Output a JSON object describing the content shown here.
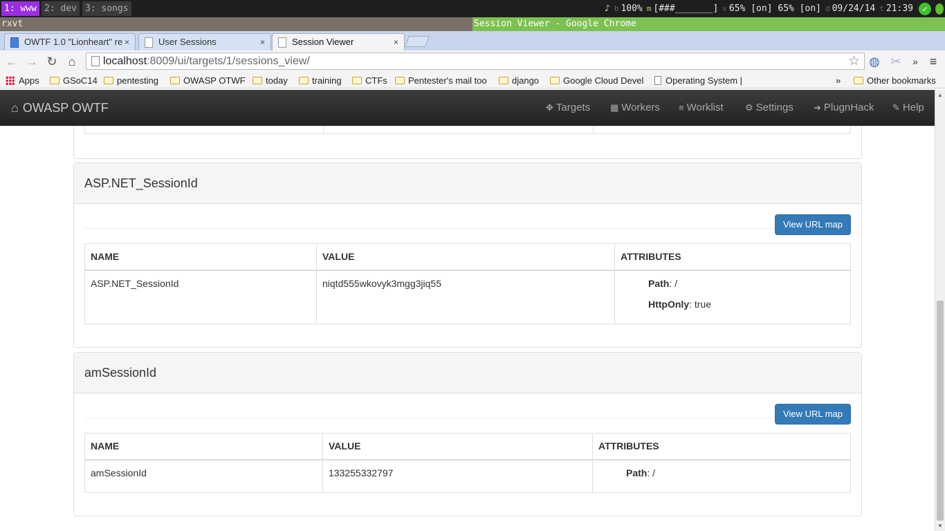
{
  "wm": {
    "workspaces": [
      "1: www",
      "2: dev",
      "3: songs"
    ],
    "status": {
      "music_icon": "♪",
      "brightness_icon": "b",
      "brightness": "100%",
      "mem_icon": "m",
      "mem_bar": "[###_______]",
      "vol_icon": "v",
      "volume": "65% [on] 65% [on]",
      "date_icon": "d",
      "date": "09/24/14",
      "time_icon": "t",
      "time": "21:39"
    }
  },
  "titlebar": {
    "left": "rxvt",
    "right": "Session Viewer - Google Chrome"
  },
  "tabs": [
    {
      "label": "OWTF 1.0 \"Lionheart\" re",
      "close": "×"
    },
    {
      "label": "User Sessions",
      "close": "×"
    },
    {
      "label": "Session Viewer",
      "close": "×"
    }
  ],
  "address": {
    "host": "localhost",
    "path": ":8009/ui/targets/1/sessions_view/"
  },
  "bookmarks": {
    "apps": "Apps",
    "items": [
      "GSoC14",
      "pentesting",
      "OWASP OTWF",
      "today",
      "training",
      "CTFs",
      "Pentester's mail too",
      "django",
      "Google Cloud Devel",
      "Operating System | "
    ],
    "more": "»",
    "other": "Other bookmarks"
  },
  "navbar": {
    "brand": "OWASP OWTF",
    "items": [
      {
        "icon": "✥",
        "label": "Targets"
      },
      {
        "icon": "▦",
        "label": "Workers"
      },
      {
        "icon": "≡",
        "label": "Worklist"
      },
      {
        "icon": "⚙",
        "label": "Settings"
      },
      {
        "icon": "➔",
        "label": "PlugnHack"
      },
      {
        "icon": "✎",
        "label": "Help"
      }
    ]
  },
  "sessions": [
    {
      "title": "ASP.NET_SessionId",
      "button": "View URL map",
      "headers": [
        "NAME",
        "VALUE",
        "ATTRIBUTES"
      ],
      "name": "ASP.NET_SessionId",
      "value": "niqtd555wkovyk3mgg3jiq55",
      "attributes": [
        {
          "key": "Path",
          "value": ": /"
        },
        {
          "key": "HttpOnly",
          "value": ": true"
        }
      ]
    },
    {
      "title": "amSessionId",
      "button": "View URL map",
      "headers": [
        "NAME",
        "VALUE",
        "ATTRIBUTES"
      ],
      "name": "amSessionId",
      "value": "133255332797",
      "attributes": [
        {
          "key": "Path",
          "value": ": /"
        }
      ]
    }
  ]
}
